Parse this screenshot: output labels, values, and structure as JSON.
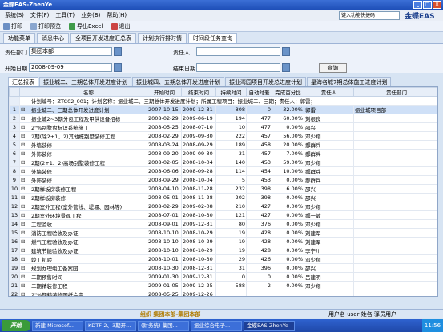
{
  "window": {
    "title": "金蝶EAS-ZhenYe"
  },
  "menu": [
    "系统(S)",
    "文件(F)",
    "工具(T)",
    "业务(B)",
    "帮助(H)"
  ],
  "search_placeholder": "键入功能快捷码",
  "brand": "金蝶EAS",
  "toolbar": {
    "print": "打印",
    "preview": "打印预览",
    "export": "导出Excel",
    "exit": "退出"
  },
  "tabs": [
    "功能菜单",
    "消息中心",
    "全项目开发进度汇总表",
    "计划执行排时情",
    "时间段任务查询"
  ],
  "filter": {
    "dept_label": "责任部门",
    "dept_value": "集团本部",
    "person_label": "责任人",
    "person_value": "",
    "start_label": "开始日期",
    "start_value": "2008-09-09",
    "end_label": "结束日期",
    "end_value": "",
    "query_btn": "查询"
  },
  "subtabs": [
    "汇总报表",
    "振业城二、三期总体开发进度计划",
    "振业城四、五期总体开发进度计划",
    "振业湾园项目开发总进度计划",
    "星海名城7期总体施工进度计划"
  ],
  "columns": [
    "",
    "",
    "名称",
    "开始时间",
    "结束时间",
    "持续时间",
    "自动时差",
    "完成百分比",
    "责任人",
    "责任部门"
  ],
  "rows": [
    [
      "",
      "计划编号：ZTC02_001；计划名称：振业城二、三期总体开发进度计划；所属工程项目：振业城二、三期；责任人：郭雷；",
      "",
      "",
      "",
      "",
      "",
      "",
      ""
    ],
    [
      "1",
      "振业城二、三期总体开发进度计划",
      "2007-10-15",
      "2009-12-31",
      "808",
      "0",
      "32.00%",
      "郭雷",
      "振业城项目部"
    ],
    [
      "2",
      "振业城2~3期分包工程及甲供设备招标",
      "2008-02-29",
      "2009-06-19",
      "194",
      "477",
      "60.00%",
      "刘根良",
      ""
    ],
    [
      "3",
      "2\"%别墅盘标识系统施工",
      "2008-05-25",
      "2008-07-10",
      "10",
      "477",
      "0.00%",
      "邵兴",
      ""
    ],
    [
      "4",
      "2期(除2+1、2)其他栋别墅装修工程",
      "2008-02-29",
      "2009-09-30",
      "222",
      "457",
      "56.00%",
      "邓少翔",
      ""
    ],
    [
      "5",
      "外墙装修",
      "2008-03-24",
      "2008-09-29",
      "189",
      "458",
      "20.00%",
      "郝群兵",
      ""
    ],
    [
      "6",
      "外饰装修",
      "2008-09-20",
      "2009-09-30",
      "31",
      "457",
      "7.00%",
      "郝群兵",
      ""
    ],
    [
      "7",
      "2期(2+1、2)高场别墅装修工程",
      "2008-02-05",
      "2008-10-04",
      "140",
      "453",
      "59.00%",
      "邓少翔",
      ""
    ],
    [
      "8",
      "外墙装修",
      "2008-06-06",
      "2008-09-28",
      "114",
      "454",
      "10.00%",
      "郝群兵",
      ""
    ],
    [
      "9",
      "外饰装修",
      "2008-09-29",
      "2008-10-04",
      "5",
      "453",
      "0.00%",
      "郝群兵",
      ""
    ],
    [
      "10",
      "2期样板房装修工程",
      "2008-04-10",
      "2008-11-28",
      "232",
      "398",
      "6.00%",
      "邵兴",
      ""
    ],
    [
      "11",
      "2期样板房装修",
      "2008-05-01",
      "2008-11-28",
      "202",
      "398",
      "0.00%",
      "邵兴",
      ""
    ],
    [
      "12",
      "2期室外工程(室外管线、堤堰、园林等)",
      "2008-02-29",
      "2009-02-08",
      "210",
      "427",
      "0.00%",
      "邓少翔",
      ""
    ],
    [
      "13",
      "2期室外环境景观工程",
      "2008-07-01",
      "2008-10-30",
      "121",
      "427",
      "0.00%",
      "郝一敏",
      ""
    ],
    [
      "14",
      "工程验收",
      "2008-09-01",
      "2009-12-31",
      "80",
      "376",
      "0.00%",
      "邓少翔",
      ""
    ],
    [
      "15",
      "消防工程验收及办证",
      "2008-10-10",
      "2008-10-29",
      "19",
      "428",
      "0.00%",
      "刘建军",
      ""
    ],
    [
      "16",
      "燃气工程验收及办证",
      "2008-10-10",
      "2008-10-29",
      "19",
      "428",
      "0.00%",
      "刘建军",
      ""
    ],
    [
      "17",
      "建筑节能验收及办证",
      "2008-10-10",
      "2008-10-29",
      "19",
      "428",
      "0.00%",
      "李宁川",
      ""
    ],
    [
      "18",
      "竣工初验",
      "2008-10-01",
      "2008-10-30",
      "29",
      "426",
      "0.00%",
      "邓少翔",
      ""
    ],
    [
      "19",
      "规划办理竣工备案园",
      "2008-10-30",
      "2008-12-31",
      "31",
      "396",
      "0.00%",
      "邵兴",
      ""
    ],
    [
      "20",
      "二期预售时间",
      "2009-01-30",
      "2009-12-31",
      "0",
      "0",
      "0.00%",
      "吕建明",
      ""
    ],
    [
      "21",
      "二期精装修工程",
      "2009-01-05",
      "2009-12-25",
      "588",
      "2",
      "0.00%",
      "邓少翔",
      ""
    ],
    [
      "22",
      "2\"%期精装修图纸会审",
      "2008-05-25",
      "2009-12-26",
      "",
      "",
      "",
      "",
      ""
    ]
  ],
  "status": {
    "org": "组织 集团本部-集团本部",
    "user": "用户名 user 姓名 驿员用户"
  },
  "taskbar": {
    "start": "开始",
    "tasks": [
      "新建 Microsof...",
      "KDTF-2、3期开...",
      "(财务统) 集团...",
      "振业综合电子...",
      "金蝶EAS-ZhenYe"
    ],
    "clock": "11:56"
  }
}
